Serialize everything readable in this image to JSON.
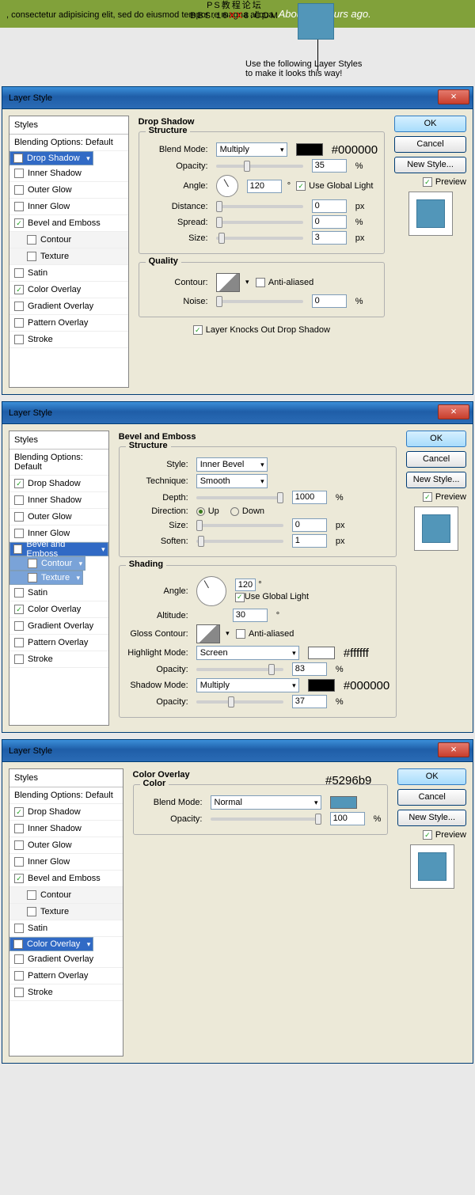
{
  "watermark": {
    "l1": "PS教程论坛",
    "l2a": "BBS.16",
    "l2x": "XX",
    "l2b": "8.COM"
  },
  "banner": {
    "text": ", consectetur adipisicing elit, sed do eiusmod tempor re magna aliqua.  ",
    "ago": "About 10 hours ago."
  },
  "callout": {
    "l1": "Use the following Layer Styles",
    "l2": "to make it looks this way!"
  },
  "dlgTitle": "Layer Style",
  "buttons": {
    "ok": "OK",
    "cancel": "Cancel",
    "new": "New Style...",
    "preview": "Preview",
    "close": "×"
  },
  "styles": {
    "head": "Styles",
    "blend": "Blending Options: Default",
    "items": [
      "Drop Shadow",
      "Inner Shadow",
      "Outer Glow",
      "Inner Glow",
      "Bevel and Emboss",
      "Contour",
      "Texture",
      "Satin",
      "Color Overlay",
      "Gradient Overlay",
      "Pattern Overlay",
      "Stroke"
    ]
  },
  "d1": {
    "title": "Drop Shadow",
    "structure": "Structure",
    "quality": "Quality",
    "blendMode": "Blend Mode:",
    "blendVal": "Multiply",
    "color": "#000000",
    "opacity": "Opacity:",
    "opacityVal": "35",
    "angle": "Angle:",
    "angleVal": "120",
    "global": "Use Global Light",
    "distance": "Distance:",
    "distanceVal": "0",
    "px": "px",
    "spread": "Spread:",
    "spreadVal": "0",
    "pct": "%",
    "size": "Size:",
    "sizeVal": "3",
    "contour": "Contour:",
    "anti": "Anti-aliased",
    "noise": "Noise:",
    "noiseVal": "0",
    "knock": "Layer Knocks Out Drop Shadow"
  },
  "d2": {
    "title": "Bevel and Emboss",
    "structure": "Structure",
    "shading": "Shading",
    "style": "Style:",
    "styleVal": "Inner Bevel",
    "tech": "Technique:",
    "techVal": "Smooth",
    "depth": "Depth:",
    "depthVal": "1000",
    "pct": "%",
    "dir": "Direction:",
    "up": "Up",
    "down": "Down",
    "size": "Size:",
    "sizeVal": "0",
    "px": "px",
    "soften": "Soften:",
    "softenVal": "1",
    "angle": "Angle:",
    "angleVal": "120",
    "deg": "°",
    "global": "Use Global Light",
    "alt": "Altitude:",
    "altVal": "30",
    "gloss": "Gloss Contour:",
    "anti": "Anti-aliased",
    "hmode": "Highlight Mode:",
    "hmodeVal": "Screen",
    "hcolor": "#ffffff",
    "hop": "Opacity:",
    "hopVal": "83",
    "smode": "Shadow Mode:",
    "smodeVal": "Multiply",
    "scolor": "#000000",
    "sop": "Opacity:",
    "sopVal": "37"
  },
  "d3": {
    "title": "Color Overlay",
    "color": "Color",
    "colorHex": "#5296b9",
    "blendMode": "Blend Mode:",
    "blendVal": "Normal",
    "opacity": "Opacity:",
    "opacityVal": "100",
    "pct": "%"
  }
}
